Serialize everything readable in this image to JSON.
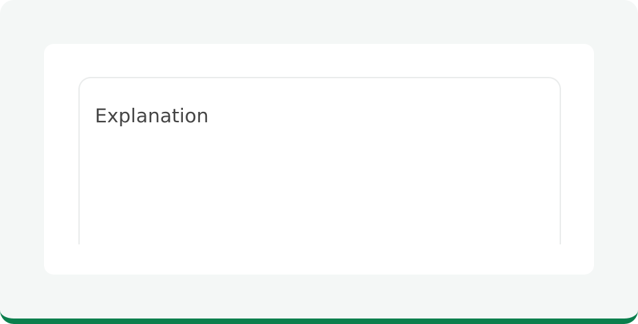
{
  "explanation_field": {
    "placeholder": "Explanation",
    "value": ""
  },
  "colors": {
    "background": "#f4f7f6",
    "panel": "#ffffff",
    "accent": "#0b7f4d",
    "field_border": "#eaecec",
    "placeholder_text": "#454545"
  }
}
